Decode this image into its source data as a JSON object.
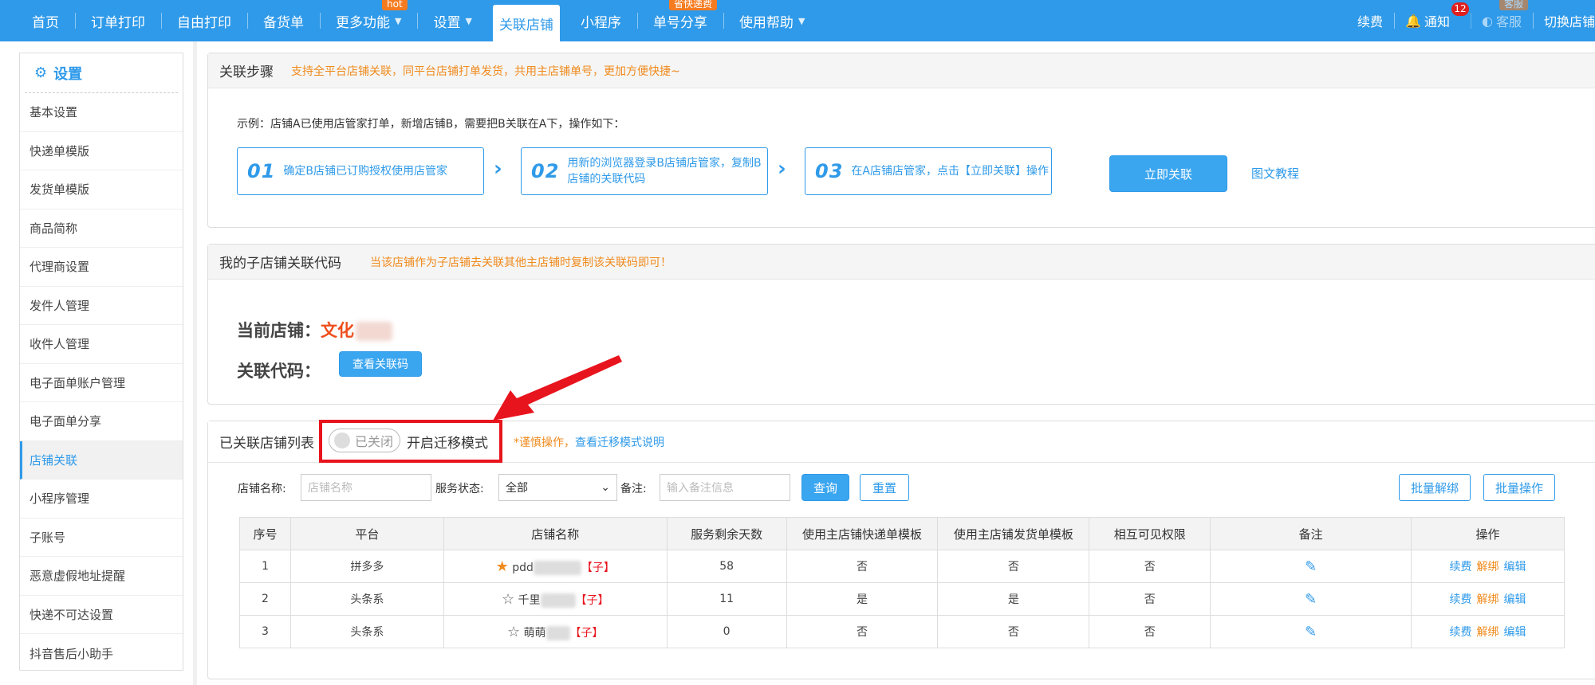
{
  "topnav": {
    "items": [
      {
        "label": "首页"
      },
      {
        "label": "订单打印"
      },
      {
        "label": "自由打印"
      },
      {
        "label": "备货单"
      },
      {
        "label": "更多功能",
        "tag": "hot",
        "arrow": "▼"
      },
      {
        "label": "设置",
        "arrow": "▼"
      },
      {
        "label": "关联店铺",
        "active": true
      },
      {
        "label": "小程序"
      },
      {
        "label": "单号分享",
        "tag": "省快递费"
      },
      {
        "label": "使用帮助",
        "arrow": "▼"
      }
    ],
    "right": {
      "renew": "续费",
      "notify": "通知",
      "notify_count": "12",
      "service": "客服",
      "service_tag": "客服",
      "switch_shop": "切换店铺"
    }
  },
  "sidebar": {
    "title": "设置",
    "items": [
      "基本设置",
      "快递单模版",
      "发货单模版",
      "商品简称",
      "代理商设置",
      "发件人管理",
      "收件人管理",
      "电子面单账户管理",
      "电子面单分享",
      "店铺关联",
      "小程序管理",
      "子账号",
      "恶意虚假地址提醒",
      "快递不可达设置",
      "抖音售后小助手"
    ],
    "active_index": 9
  },
  "steps_panel": {
    "title": "关联步骤",
    "tip": "支持全平台店铺关联，同平台店铺打单发货，共用主店铺单号，更加方便快捷~",
    "example": "示例：店铺A已使用店管家打单，新增店铺B，需要把B关联在A下，操作如下：",
    "steps": [
      {
        "num": "01",
        "text": "确定B店铺已订购授权使用店管家"
      },
      {
        "num": "02",
        "text": "用新的浏览器登录B店铺店管家，复制B店铺的关联代码"
      },
      {
        "num": "03",
        "text": "在A店铺店管家，点击【立即关联】操作"
      }
    ],
    "link_now": "立即关联",
    "tutorial": "图文教程"
  },
  "code_panel": {
    "title": "我的子店铺关联代码",
    "tip": "当该店铺作为子店铺去关联其他主店铺时复制该关联码即可！",
    "current_label": "当前店铺：",
    "current_shop": "文化",
    "code_label": "关联代码：",
    "view_code": "查看关联码"
  },
  "list_panel": {
    "title": "已关联店铺列表",
    "toggle_state": "已关闭",
    "migrate_label": "开启迁移模式",
    "caution": "*谨慎操作，",
    "migrate_help": "查看迁移模式说明",
    "filters": {
      "shop_label": "店铺名称:",
      "shop_placeholder": "店铺名称",
      "status_label": "服务状态:",
      "status_value": "全部",
      "remark_label": "备注:",
      "remark_placeholder": "输入备注信息",
      "query": "查询",
      "reset": "重置",
      "batch_unbind": "批量解绑",
      "batch_ops": "批量操作"
    },
    "columns": [
      "序号",
      "平台",
      "店铺名称",
      "服务剩余天数",
      "使用主店铺快递单模板",
      "使用主店铺发货单模板",
      "相互可见权限",
      "备注",
      "操作"
    ],
    "rows": [
      {
        "idx": "1",
        "platform": "拼多多",
        "starred": true,
        "name": "pdd",
        "tag": "【子】",
        "days": "58",
        "express_tpl": "否",
        "ship_tpl": "否",
        "visible": "否"
      },
      {
        "idx": "2",
        "platform": "头条系",
        "starred": false,
        "name": "千里",
        "tag": "【子】",
        "days": "11",
        "express_tpl": "是",
        "ship_tpl": "是",
        "visible": "否"
      },
      {
        "idx": "3",
        "platform": "头条系",
        "starred": false,
        "name": "萌萌",
        "tag": "【子】",
        "days": "0",
        "express_tpl": "否",
        "ship_tpl": "否",
        "visible": "否"
      }
    ],
    "ops": {
      "renew": "续费",
      "unbind": "解绑",
      "edit": "编辑"
    }
  },
  "colors": {
    "brand": "#2f9ae9",
    "accent": "#f08a1c",
    "danger": "#e8141d"
  }
}
